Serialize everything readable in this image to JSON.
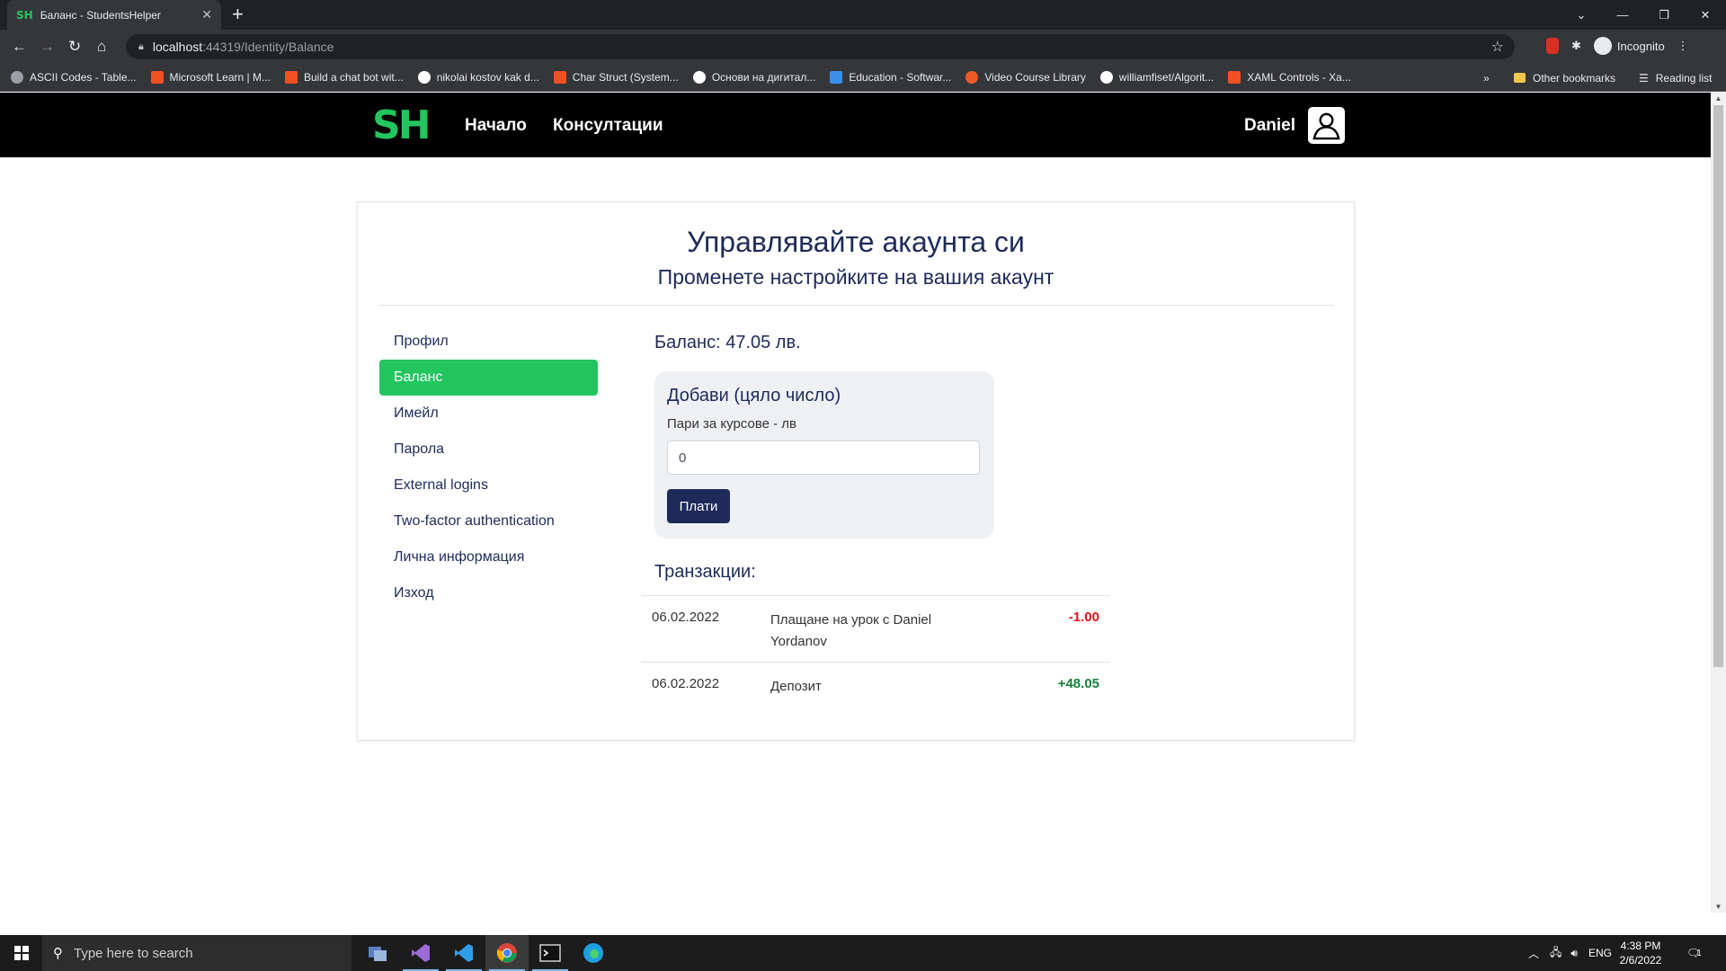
{
  "browser": {
    "tab_title": "Баланс - StudentsHelper",
    "tab_favicon": "SH",
    "url_host": "localhost",
    "url_path": ":44319/Identity/Balance",
    "profile_label": "Incognito",
    "bookmarks": [
      {
        "label": "ASCII Codes - Table...",
        "icon": "globe-icon",
        "color": "#9aa0a6"
      },
      {
        "label": "Microsoft Learn | M...",
        "icon": "microsoft-icon",
        "color": "#f25022"
      },
      {
        "label": "Build a chat bot wit...",
        "icon": "microsoft-icon",
        "color": "#f25022"
      },
      {
        "label": "nikolai kostov kak d...",
        "icon": "google-icon",
        "color": "#ffffff"
      },
      {
        "label": "Char Struct (System...",
        "icon": "microsoft-icon",
        "color": "#f25022"
      },
      {
        "label": "Основи на дигитал...",
        "icon": "google-icon",
        "color": "#ffffff"
      },
      {
        "label": "Education - Softwar...",
        "icon": "azure-icon",
        "color": "#3b8eea"
      },
      {
        "label": "Video Course Library",
        "icon": "play-icon",
        "color": "#f05a28"
      },
      {
        "label": "williamfiset/Algorit...",
        "icon": "github-icon",
        "color": "#ffffff"
      },
      {
        "label": "XAML Controls - Xa...",
        "icon": "microsoft-icon",
        "color": "#f25022"
      }
    ],
    "other_bookmarks": "Other bookmarks",
    "reading_list": "Reading list",
    "overflow": "»"
  },
  "site": {
    "logo": "SH",
    "logo_color": "#22c55e",
    "nav": [
      "Начало",
      "Консултации"
    ],
    "user_name": "Daniel"
  },
  "page": {
    "title": "Управлявайте акаунта си",
    "subtitle": "Променете настройките на вашия акаунт",
    "menu": [
      {
        "label": "Профил",
        "active": false
      },
      {
        "label": "Баланс",
        "active": true
      },
      {
        "label": "Имейл",
        "active": false
      },
      {
        "label": "Парола",
        "active": false
      },
      {
        "label": "External logins",
        "active": false
      },
      {
        "label": "Two-factor authentication",
        "active": false
      },
      {
        "label": "Лична информация",
        "active": false
      },
      {
        "label": "Изход",
        "active": false
      }
    ],
    "balance_text": "Баланс: 47.05 лв.",
    "form": {
      "title": "Добави (цяло число)",
      "label": "Пари за курсове - лв",
      "input_value": "0",
      "button": "Плати"
    },
    "transactions_title": "Транзакции:",
    "transactions": [
      {
        "date": "06.02.2022",
        "description": "Плащане на урок с Daniel Yordanov",
        "amount": "-1.00",
        "sign": "neg"
      },
      {
        "date": "06.02.2022",
        "description": "Депозит",
        "amount": "+48.05",
        "sign": "pos"
      }
    ],
    "accent_color": "#22c55e",
    "primary_color": "#1e2a5a"
  },
  "taskbar": {
    "search_placeholder": "Type here to search",
    "language": "ENG",
    "time": "4:38 PM",
    "date": "2/6/2022",
    "notification_count": "1"
  }
}
